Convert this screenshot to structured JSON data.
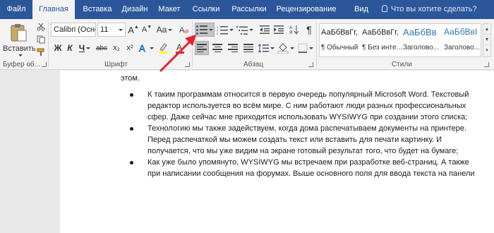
{
  "tabs": {
    "file": "Файл",
    "home": "Главная",
    "insert": "Вставка",
    "design": "Дизайн",
    "layout": "Макет",
    "references": "Ссылки",
    "mailings": "Рассылки",
    "review": "Рецензирование",
    "view": "Вид",
    "tell_me": "Что вы хотите сделать?"
  },
  "ribbon": {
    "clipboard": {
      "paste_label": "Вставить",
      "group_label": "Буфер об..."
    },
    "font": {
      "font_name": "Calibri (Осно",
      "font_size": "11",
      "grow": "A",
      "shrink": "A",
      "case": "Aa",
      "bold": "Ж",
      "italic": "К",
      "underline": "Ч",
      "strike": "abc",
      "subscript": "x₂",
      "superscript": "x²",
      "group_label": "Шрифт"
    },
    "paragraph": {
      "pilcrow": "¶",
      "group_label": "Абзац"
    },
    "styles": {
      "items": [
        {
          "sample": "АаБбВвГг,",
          "name": "¶ Обычный"
        },
        {
          "sample": "АаБбВвГг,",
          "name": "¶ Без инте..."
        },
        {
          "sample": "АаБбВв",
          "name": "Заголово..."
        },
        {
          "sample": "АаБбВвІ",
          "name": "Заголово..."
        }
      ],
      "group_label": "Стили"
    }
  },
  "document": {
    "lead_text": "этом.",
    "bullets": [
      {
        "lines": [
          "К таким программам относится в первую очередь популярный Microsoft Word. Текстовый",
          "редактор используется во всём мире. С ним работают люди разных профессиональных",
          "сфер. Даже сейчас мне приходится использовать WYSIWYG при создании этого списка;"
        ]
      },
      {
        "lines": [
          "Технологию мы также задействуем, когда дома распечатываем документы на принтере.",
          "Перед распечаткой мы можем создать текст или вставить для печати картинку. И",
          "получается, что мы уже видим на экране готовый результат того, что будет на бумаге;"
        ]
      },
      {
        "lines": [
          "Как уже было упомянуто, WYSIWYG мы встречаем при разработке веб-страниц. А также",
          "при написании сообщения на форумах. Выше основного поля для ввода текста на панели"
        ]
      }
    ]
  },
  "colors": {
    "tab_bar": "#2b579a",
    "ribbon_bg": "#f3f3f3",
    "annotation_arrow": "#e8202a",
    "heading_style": "#2e74b5"
  }
}
